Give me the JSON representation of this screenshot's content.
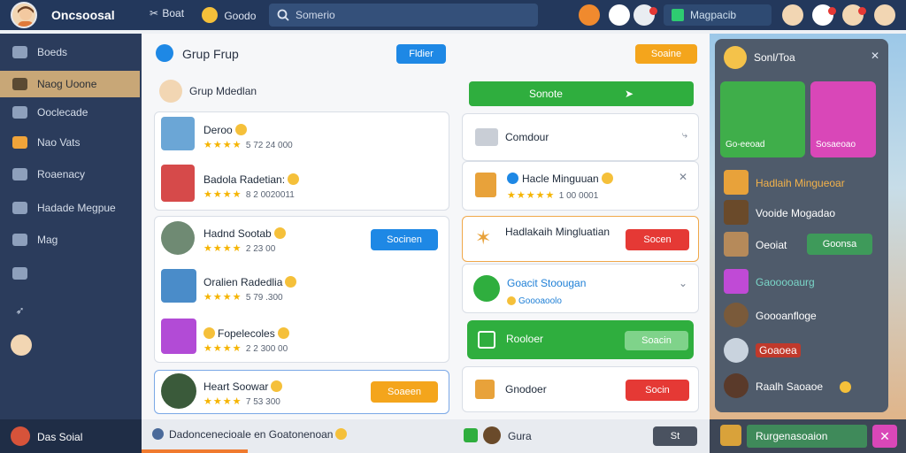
{
  "topbar": {
    "brand": "Oncsoosal",
    "nav1": "Boat",
    "nav2": "Goodo",
    "search_placeholder": "Somerio",
    "messages_label": "Magpacib",
    "accent": "#23385c"
  },
  "sidebar": {
    "items": [
      {
        "label": "Boeds",
        "icon": "image-icon"
      },
      {
        "label": "Naog Uoone",
        "icon": "folder-icon"
      },
      {
        "label": "Ooclecade",
        "icon": "gallery-icon"
      },
      {
        "label": "Nao Vats",
        "icon": "gift-icon"
      },
      {
        "label": "Roaenacy",
        "icon": "grid-icon"
      },
      {
        "label": "Hadade Megpue",
        "icon": "calendar-icon"
      },
      {
        "label": "Mag",
        "icon": "photo-icon"
      }
    ],
    "active_index": 1
  },
  "bottombar": {
    "user": "Das Soial",
    "notice": "Dadoncenecioale en Goatonenoan",
    "center_label": "Gura",
    "count": "St",
    "input_value": "Rurgenasoaion"
  },
  "group": {
    "title": "Grup Frup",
    "join_btn": "Fldier",
    "sub_title": "Grup Mdedlan",
    "action_btn": "Soaine",
    "members": [
      {
        "name": "Deroo",
        "meta": "5 72 24 000",
        "btn": ""
      },
      {
        "name": "Badola Radetian:",
        "meta": "8 2 0020011",
        "btn": ""
      },
      {
        "name": "Hadnd Sootab",
        "meta": "2 23 00",
        "btn": "Socinen"
      },
      {
        "name": "Oralien Radedlia",
        "meta": "5 79 .300",
        "btn": ""
      },
      {
        "name": "Fopelecoles",
        "meta": "2 2 300 00",
        "btn": ""
      },
      {
        "name": "Heart Soowar",
        "meta": "7 53 300",
        "btn": "Soaeen"
      }
    ]
  },
  "middle": {
    "go_btn": "Sonote",
    "items": [
      {
        "title": "Comdour",
        "sub": "",
        "btn": ""
      },
      {
        "title": "Hacle Minguuan",
        "sub": "1 00 0001",
        "btn": ""
      },
      {
        "title": "Hadlakaih Mingluatian",
        "sub": "",
        "btn": "Socen"
      },
      {
        "title": "Goacit Stoougan",
        "sub": "Goooaoolo",
        "btn": ""
      },
      {
        "title": "Rooloer",
        "sub": "",
        "btn": "Soacin"
      },
      {
        "title": "Gnodoer",
        "sub": "",
        "btn": "Socin"
      }
    ]
  },
  "rightpanel": {
    "title": "Sonl/Toa",
    "tiles": [
      "Go-eeoad",
      "Sosaeoao"
    ],
    "rows": [
      {
        "label": "Hadlaih Mingueoar"
      },
      {
        "label": "Vooide Mogadao"
      },
      {
        "label": "Oeoiat",
        "btn": "Goonsa"
      },
      {
        "label": "Gaooooaurg"
      },
      {
        "label": "Goooanfloge"
      },
      {
        "label": "Goaoea"
      },
      {
        "label": "Raalh Saoaoe"
      }
    ]
  }
}
